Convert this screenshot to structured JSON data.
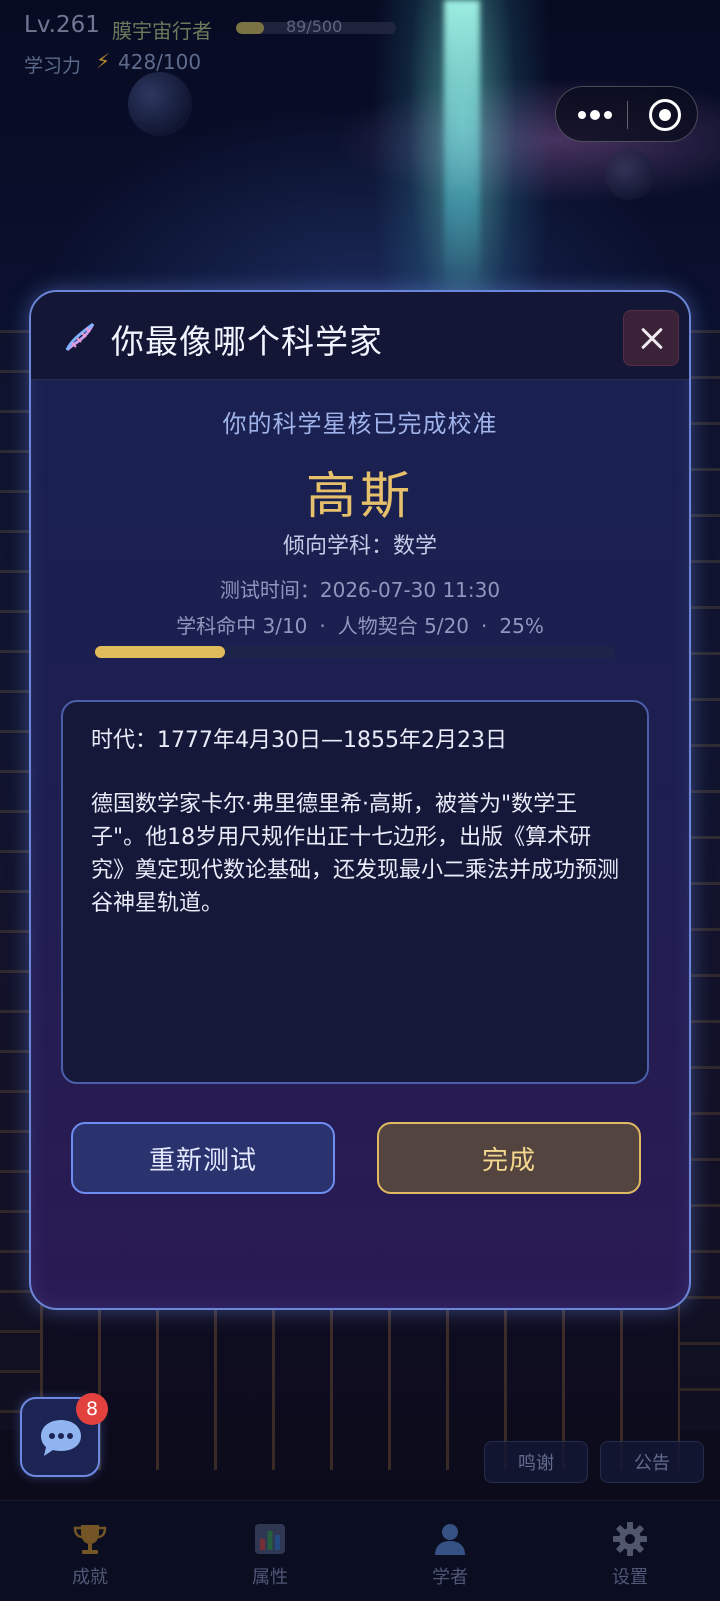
{
  "hud": {
    "level": "Lv.261",
    "rank_title": "膜宇宙行者",
    "xp_text": "89/500",
    "xp_fraction": 0.178,
    "power_label": "学习力",
    "power_value": "428/100"
  },
  "modal": {
    "title": "你最像哪个科学家",
    "subtitle": "你的科学星核已完成校准",
    "result_name": "高斯",
    "subject": "倾向学科：数学",
    "test_time": "测试时间：2026-07-30 11:30",
    "stats": {
      "subject_hit": "学科命中 3/10",
      "separator": "·",
      "character_match": "人物契合 5/20",
      "percent": "25%"
    },
    "progress_fraction": 0.25,
    "era": "时代：1777年4月30日—1855年2月23日",
    "bio": "德国数学家卡尔·弗里德里希·高斯，被誉为\"数学王子\"。他18岁用尺规作出正十七边形，出版《算术研究》奠定现代数论基础，还发现最小二乘法并成功预测谷神星轨道。",
    "retry_label": "重新测试",
    "done_label": "完成"
  },
  "chat": {
    "badge_count": "8"
  },
  "tags": {
    "thanks": "鸣谢",
    "notice": "公告"
  },
  "nav": {
    "items": [
      {
        "label": "成就",
        "icon": "trophy-icon"
      },
      {
        "label": "属性",
        "icon": "bar-chart-icon"
      },
      {
        "label": "学者",
        "icon": "user-icon"
      },
      {
        "label": "设置",
        "icon": "gear-icon"
      }
    ]
  },
  "colors": {
    "accent_gold": "#e0bc5c",
    "accent_blue": "#6f8cf0",
    "badge_red": "#e2413d"
  }
}
